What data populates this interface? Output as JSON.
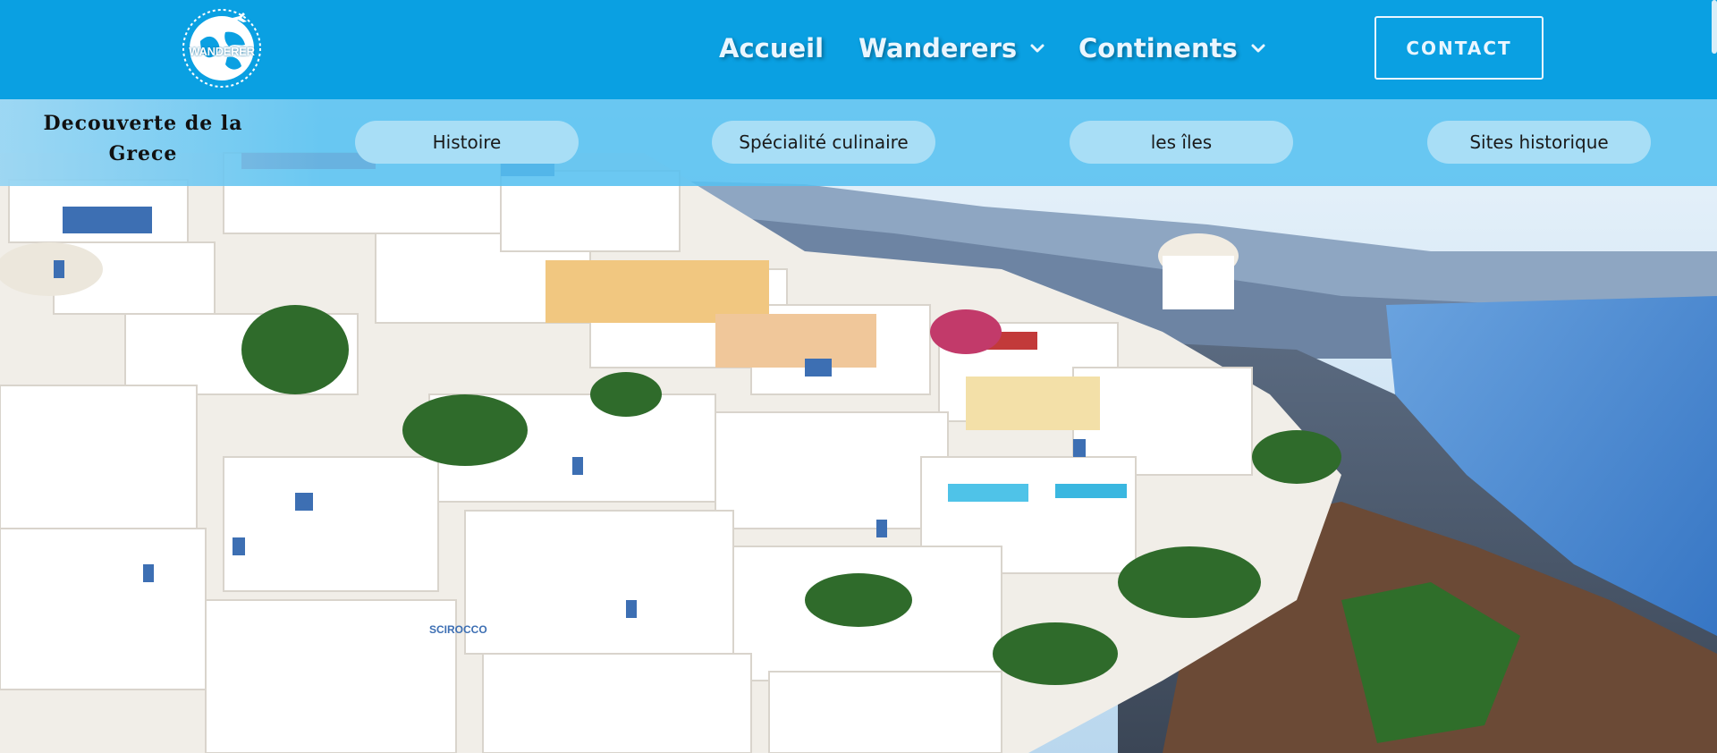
{
  "header": {
    "logo_text": "WANDERER",
    "nav": [
      {
        "label": "Accueil",
        "has_dropdown": false
      },
      {
        "label": "Wanderers",
        "has_dropdown": true
      },
      {
        "label": "Continents",
        "has_dropdown": true
      }
    ],
    "contact_label": "CONTACT"
  },
  "subnav": {
    "title": "Decouverte de la Grece",
    "items": [
      {
        "label": "Histoire"
      },
      {
        "label": "Spécialité culinaire"
      },
      {
        "label": "les îles"
      },
      {
        "label": "Sites historique"
      }
    ]
  },
  "hero": {
    "icon": "santorini-photo",
    "sign_text": "SCIROCCO"
  },
  "colors": {
    "topbar": "#0aa0e2",
    "subbar": "#56c0f0",
    "pill": "#a8def6",
    "text_light": "#eaf6ff"
  }
}
